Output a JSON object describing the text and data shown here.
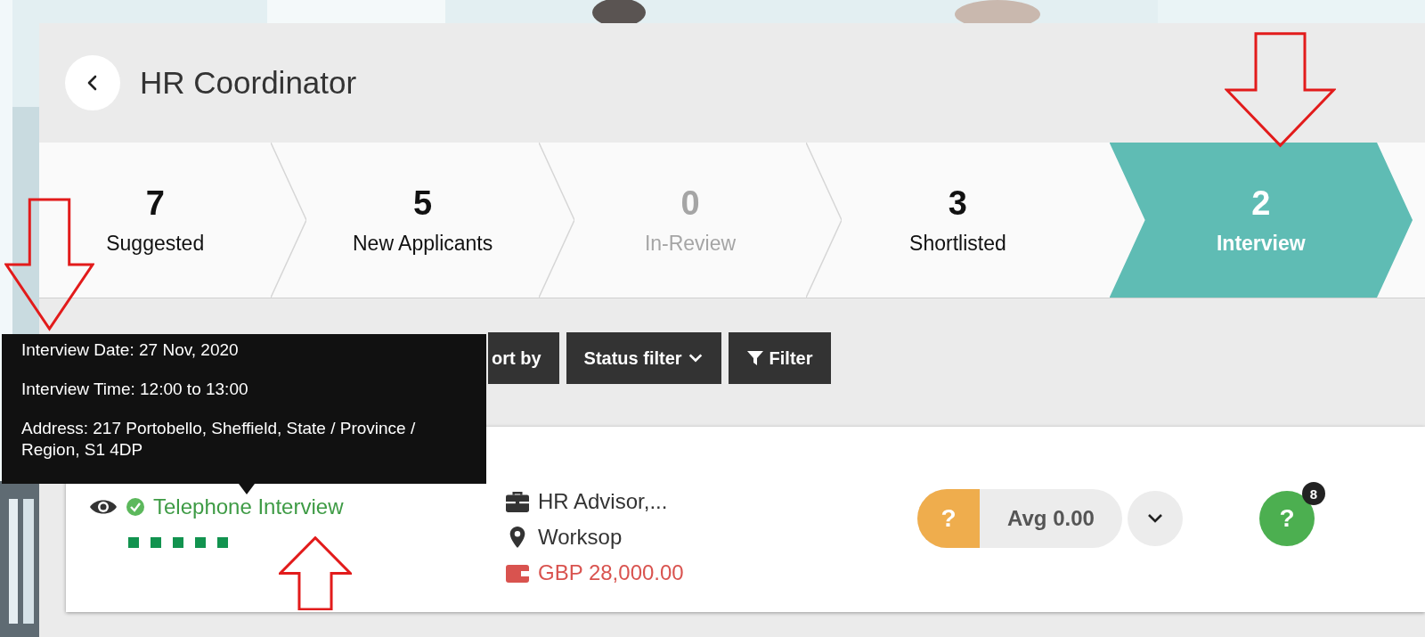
{
  "header": {
    "title": "HR Coordinator"
  },
  "steps": [
    {
      "count": "7",
      "label": "Suggested",
      "selected": false,
      "muted": false
    },
    {
      "count": "5",
      "label": "New Applicants",
      "selected": false,
      "muted": false
    },
    {
      "count": "0",
      "label": "In-Review",
      "selected": false,
      "muted": true
    },
    {
      "count": "3",
      "label": "Shortlisted",
      "selected": false,
      "muted": false
    },
    {
      "count": "2",
      "label": "Interview",
      "selected": true,
      "muted": false
    }
  ],
  "toolbar": [
    {
      "label": "ort by",
      "kind": "plain"
    },
    {
      "label": "Status filter",
      "kind": "dropdown"
    },
    {
      "label": "Filter",
      "kind": "filter"
    }
  ],
  "tooltip": [
    "Interview Date: 27 Nov, 2020",
    "Interview Time: 12:00 to 13:00",
    "Address: 217 Portobello, Sheffield, State / Province / Region, S1 4DP"
  ],
  "candidate": {
    "stage": "Telephone Interview",
    "stage_done": true,
    "job": "HR Advisor,...",
    "location": "Worksop",
    "salary": "GBP 28,000.00",
    "score": "?",
    "average": "Avg 0.00",
    "questions": "?",
    "question_count": "8"
  },
  "annotations": [
    {
      "kind": "down-arrow"
    },
    {
      "kind": "down-arrow"
    },
    {
      "kind": "up-arrow"
    }
  ]
}
